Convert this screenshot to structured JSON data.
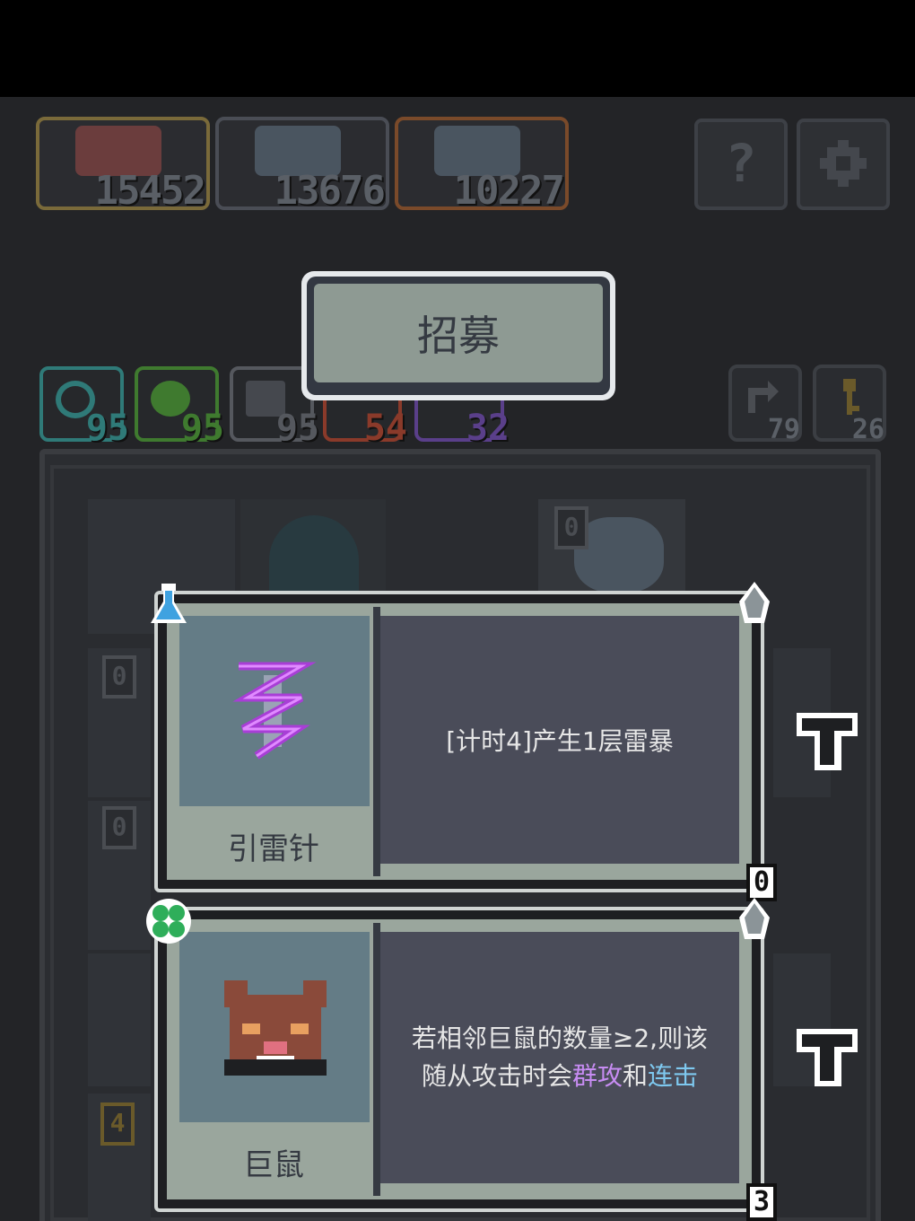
{
  "leaderboard": [
    {
      "score": "15452",
      "border": "#7a6a3a",
      "portrait": "#6b3d3d"
    },
    {
      "score": "13676",
      "border": "#4a4d55",
      "portrait": "#4a5560"
    },
    {
      "score": "10227",
      "border": "#7a4a2a",
      "portrait": "#4a5560"
    }
  ],
  "header_buttons": {
    "help_icon": "question-icon",
    "settings_icon": "gear-icon",
    "help_glyph": "?"
  },
  "recruit": {
    "label": "招募"
  },
  "resources": [
    {
      "value": "95",
      "color": "#2f7a78",
      "icon": "swirl-icon"
    },
    {
      "value": "95",
      "color": "#3f7a2f",
      "icon": "leaf-icon"
    },
    {
      "value": "95",
      "color": "#55585e",
      "icon": "wing-icon"
    },
    {
      "value": "54",
      "color": "#8a3a2a",
      "icon": "fire-icon"
    },
    {
      "value": "32",
      "color": "#5a3f8a",
      "icon": "arcane-icon"
    }
  ],
  "side_resources": [
    {
      "value": "79",
      "icon": "refresh-icon"
    },
    {
      "value": "26",
      "icon": "key-icon"
    }
  ],
  "board": {
    "tags": [
      "0",
      "0",
      "0",
      "4"
    ]
  },
  "cards": [
    {
      "name": "引雷针",
      "description": "[计时4]产生1层雷暴",
      "count": "0",
      "badge_icon": "flask-icon",
      "art_icon": "lightning-rod-icon",
      "rarity_icon": "arrowhead-icon",
      "side_icon": "sword-icon"
    },
    {
      "name": "巨鼠",
      "description_parts": [
        "若相邻巨鼠的数量≥2,则该",
        "随从攻击时会",
        "群攻",
        "和",
        "连击"
      ],
      "count": "3",
      "badge_icon": "clover-icon",
      "art_icon": "rat-icon",
      "rarity_icon": "arrowhead-icon",
      "side_icon": "sword-icon"
    }
  ],
  "colors": {
    "accent_purple": "#c78cf2",
    "accent_cyan": "#7ec8ef"
  }
}
